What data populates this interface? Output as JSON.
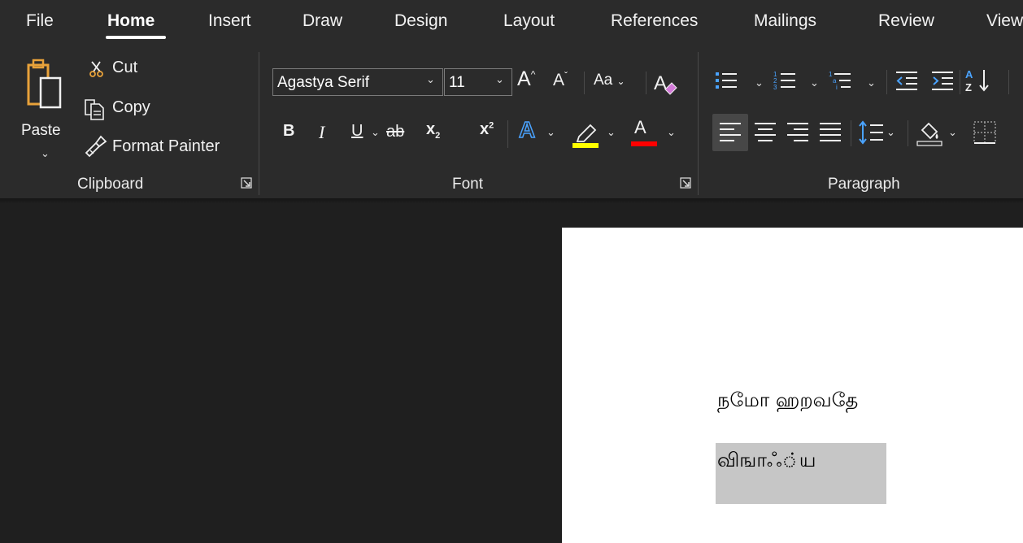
{
  "tabs": [
    "File",
    "Home",
    "Insert",
    "Draw",
    "Design",
    "Layout",
    "References",
    "Mailings",
    "Review",
    "View"
  ],
  "active_tab": "Home",
  "clipboard": {
    "paste_label": "Paste",
    "cut_label": "Cut",
    "copy_label": "Copy",
    "format_painter_label": "Format Painter",
    "group_label": "Clipboard"
  },
  "font": {
    "font_name": "Agastya Serif",
    "font_size": "11",
    "change_case_label": "Aa",
    "bold_label": "B",
    "italic_label": "I",
    "underline_label": "U",
    "strike_label": "ab",
    "subscript_label": "x",
    "superscript_label": "x",
    "text_effects_label": "A",
    "font_color_label": "A",
    "group_label": "Font",
    "highlight_color": "#ffff00",
    "font_color": "#ff0000"
  },
  "paragraph": {
    "group_label": "Paragraph"
  },
  "document": {
    "lines": [
      "நமோ ஹறவதே",
      "விஙாஃ்ய"
    ]
  }
}
